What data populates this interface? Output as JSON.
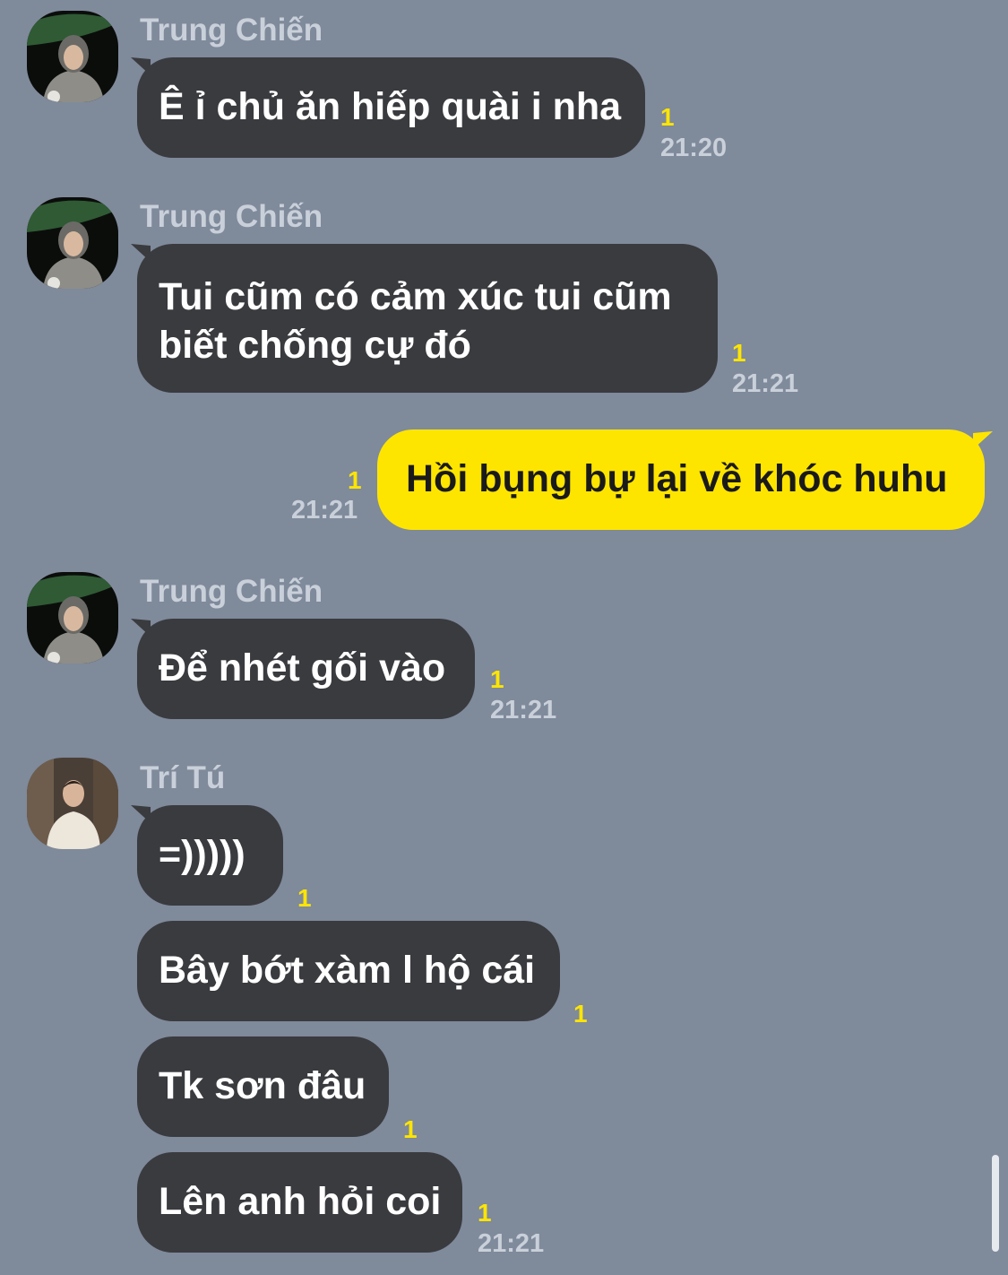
{
  "messages": [
    {
      "sender": "Trung Chiến",
      "text": "Ê ỉ chủ ăn hiếp quài i nha",
      "unread": "1",
      "time": "21:20"
    },
    {
      "sender": "Trung Chiến",
      "text": "Tui cũm có cảm xúc tui cũm biết chống cự đó",
      "unread": "1",
      "time": "21:21"
    },
    {
      "sender": "me",
      "text": "Hồi bụng bự lại về khóc huhu",
      "unread": "1",
      "time": "21:21"
    },
    {
      "sender": "Trung Chiến",
      "text": "Để nhét gối vào",
      "unread": "1",
      "time": "21:21"
    },
    {
      "sender": "Trí Tú",
      "text": "=)))))",
      "unread": "1",
      "time": ""
    },
    {
      "sender": "Trí Tú",
      "text": "Bây bớt xàm l hộ cái",
      "unread": "1",
      "time": ""
    },
    {
      "sender": "Trí Tú",
      "text": "Tk sơn đâu",
      "unread": "1",
      "time": ""
    },
    {
      "sender": "Trí Tú",
      "text": "Lên anh hỏi coi",
      "unread": "1",
      "time": "21:21"
    }
  ],
  "colors": {
    "background": "#7f8a9b",
    "incoming_bubble": "#3a3b3f",
    "outgoing_bubble": "#fee500",
    "unread_count": "#fee500",
    "meta_text": "#c9d0da"
  },
  "icons": {
    "avatar_trung_chien": "profile-photo",
    "avatar_tri_tu": "profile-photo"
  }
}
